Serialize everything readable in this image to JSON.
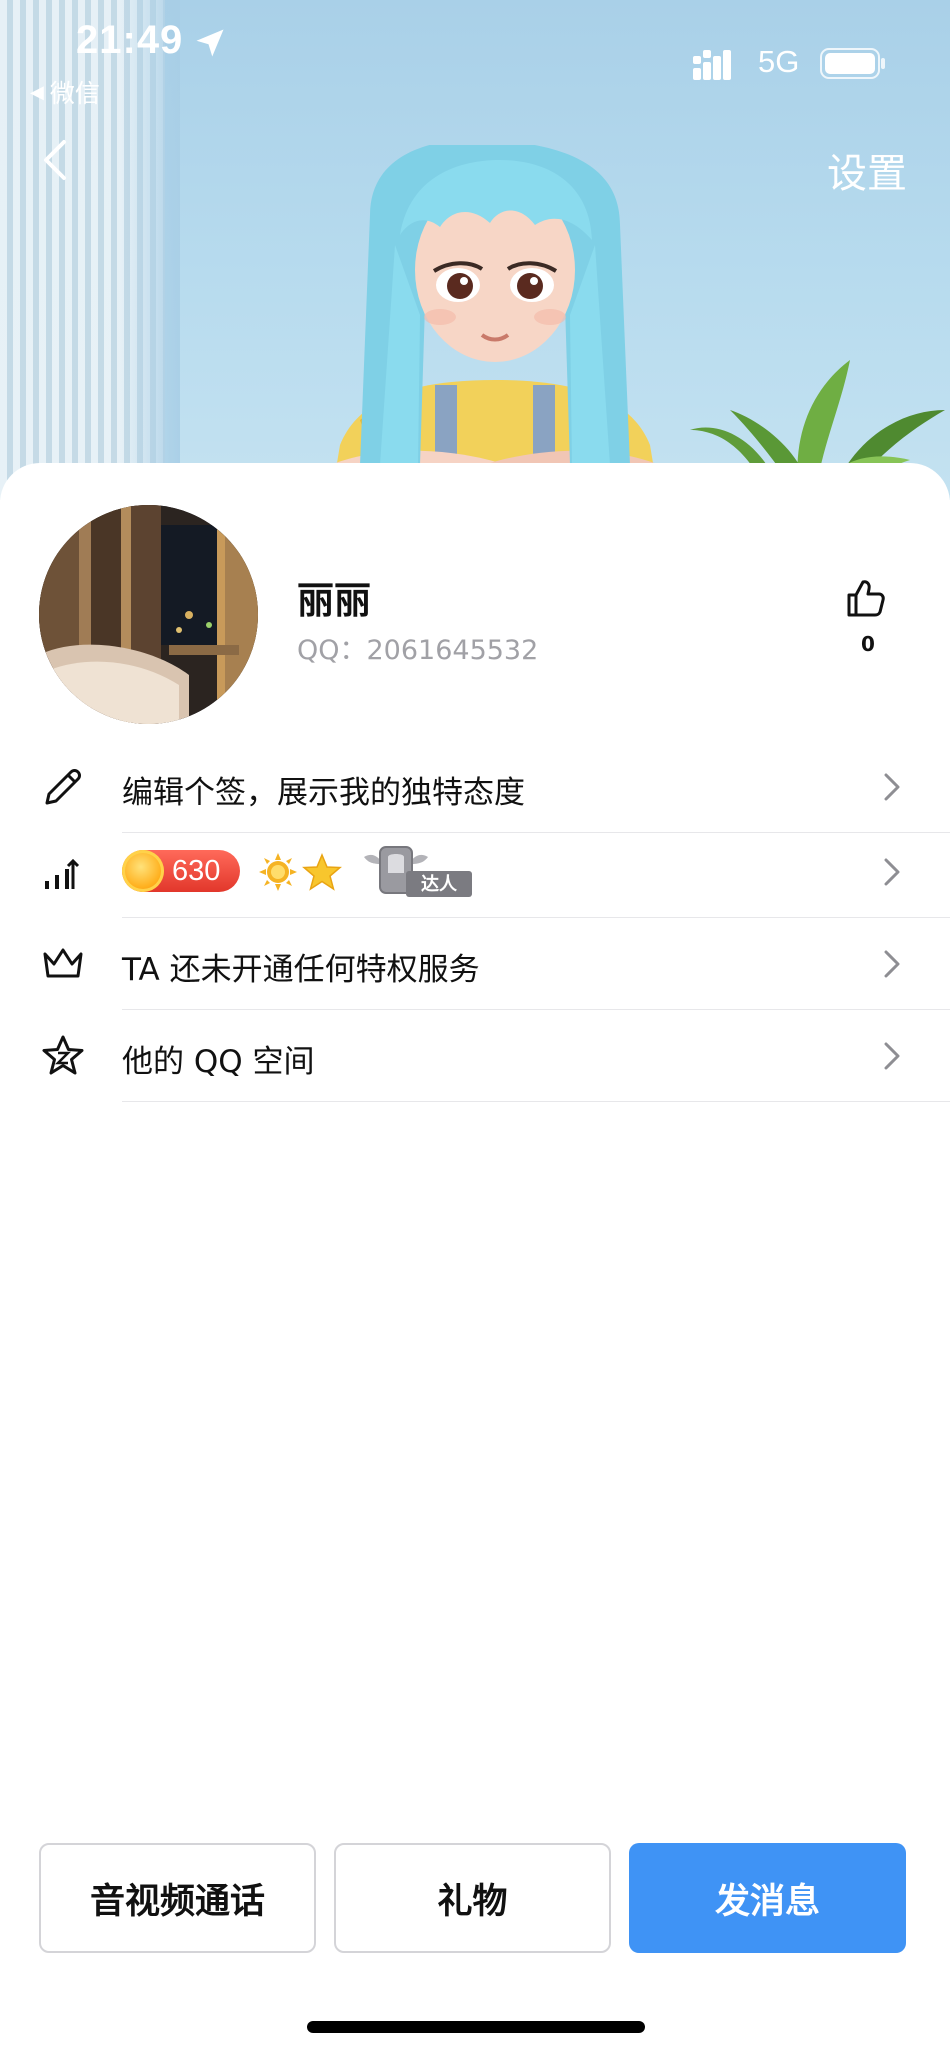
{
  "status_bar": {
    "time": "21:49",
    "back_app": "微信",
    "network": "5G"
  },
  "nav": {
    "settings_label": "设置"
  },
  "profile": {
    "nickname": "丽丽",
    "qq_id": "QQ：2061645532",
    "like_count": "0"
  },
  "rows": [
    {
      "icon": "pencil-icon",
      "label": "编辑个签，展示我的独特态度"
    },
    {
      "icon": "level-bars-icon",
      "label": "",
      "level_value": "630",
      "badge_text": "达人"
    },
    {
      "icon": "crown-icon",
      "label": "TA 还未开通任何特权服务"
    },
    {
      "icon": "qzone-star-icon",
      "label": "他的 QQ 空间"
    }
  ],
  "buttons": {
    "call": "音视频通话",
    "gift": "礼物",
    "message": "发消息"
  },
  "colors": {
    "primary": "#3f93f5",
    "level_badge": "#e2372b",
    "divider": "#e7e7ea"
  }
}
